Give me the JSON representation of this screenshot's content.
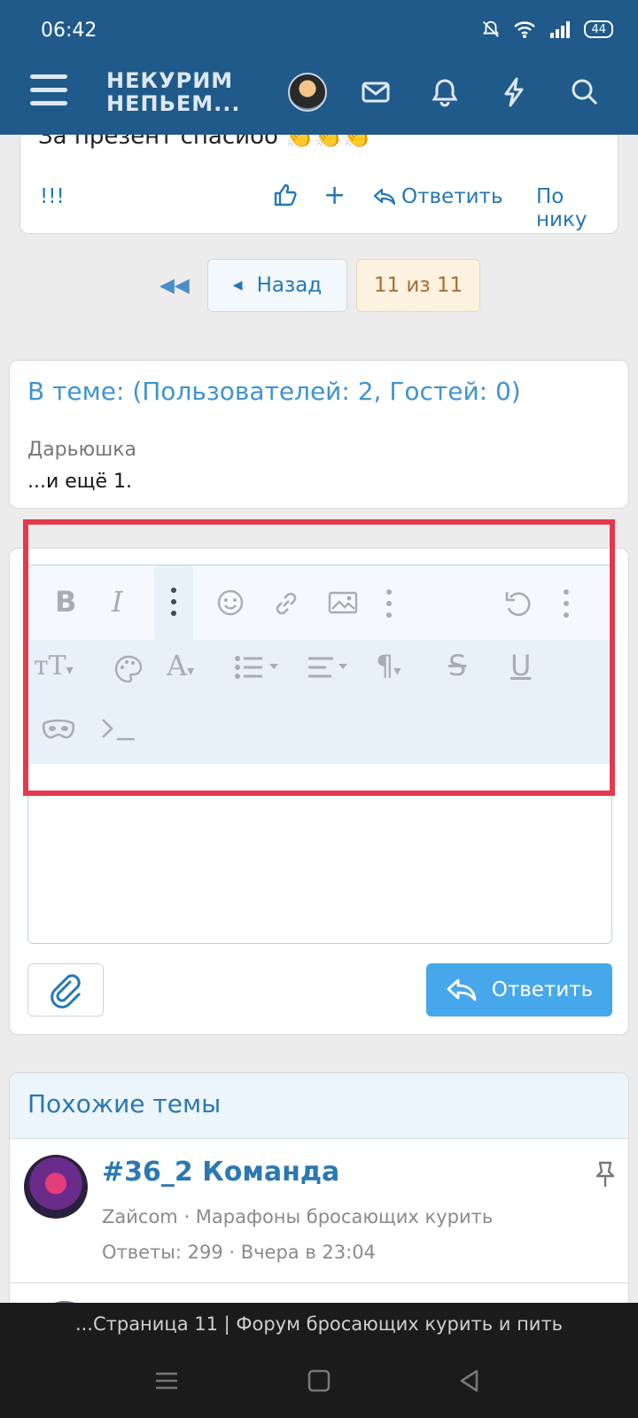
{
  "status": {
    "time": "06:42",
    "battery": "44"
  },
  "header": {
    "logo_line1": "НЕКУРИМ",
    "logo_line2": "НЕПЬЕМ..."
  },
  "post": {
    "cut_text": "За презент спасибо 👏👏👏",
    "left_label": "!!!",
    "reply_label": "Ответить",
    "bynick_label": "По нику"
  },
  "pagination": {
    "back_label": "Назад",
    "current_label": "11 из 11"
  },
  "online": {
    "title": "В теме: (Пользователей: 2, Гостей: 0)",
    "user": "Дарьюшка",
    "more": "...и ещё 1."
  },
  "editor": {
    "reply_button_label": "Ответить",
    "toolbar": [
      "bold",
      "italic",
      "more-vertical",
      "smiley",
      "link",
      "image",
      "more-vertical",
      "undo",
      "more-vertical",
      "text-size",
      "palette",
      "font-color",
      "list",
      "align",
      "paragraph",
      "strikethrough",
      "underline",
      "spoiler-mask",
      "code-prompt"
    ]
  },
  "similar": {
    "heading": "Похожие темы",
    "topics": [
      {
        "title": "#36_2 Команда",
        "author": "Zaйcom",
        "forum": "Марафоны бросающих курить",
        "meta": "Ответы: 299 · Вчера в 23:04"
      }
    ]
  },
  "browser": {
    "page_title": "...Страница 11 | Форум бросающих курить и пить"
  }
}
